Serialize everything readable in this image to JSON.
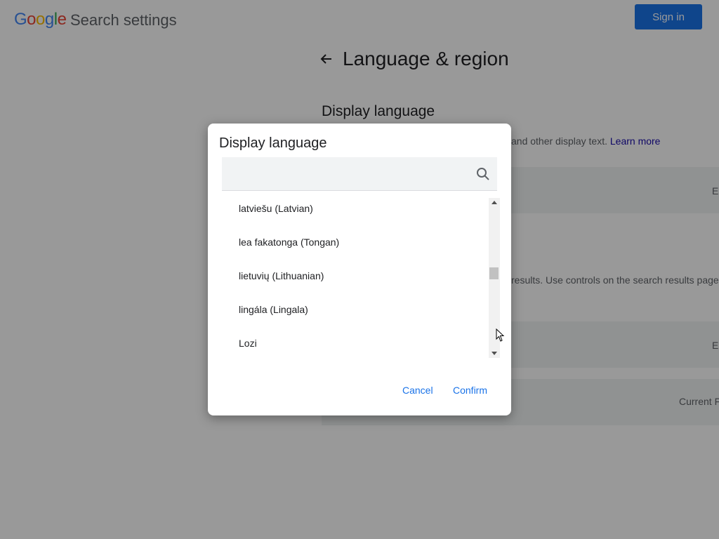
{
  "header": {
    "logo_letters": [
      "G",
      "o",
      "o",
      "g",
      "l",
      "e"
    ],
    "logo_colors": [
      "#4285f4",
      "#ea4335",
      "#fbbc05",
      "#4285f4",
      "#34a853",
      "#ea4335"
    ],
    "title": "Search settings",
    "sign_in_label": "Sign in"
  },
  "main": {
    "back_icon": "arrow-left-icon",
    "page_title": "Language & region",
    "section_title": "Display language",
    "section_desc": "and other display text.",
    "learn_more": "Learn more",
    "row1_value": "E",
    "search_results_desc": "results. Use controls on the search results page",
    "row2_value": "E",
    "row3_value": "Current F"
  },
  "dialog": {
    "title": "Display language",
    "search": {
      "value": "",
      "placeholder": "",
      "icon": "search-icon"
    },
    "languages": [
      "latviešu  (Latvian)",
      "lea fakatonga  (Tongan)",
      "lietuvių  (Lithuanian)",
      "lingála  (Lingala)",
      "Lozi"
    ],
    "cancel_label": "Cancel",
    "confirm_label": "Confirm"
  },
  "colors": {
    "accent": "#1a73e8",
    "overlay": "rgba(0,0,0,0.40)"
  }
}
